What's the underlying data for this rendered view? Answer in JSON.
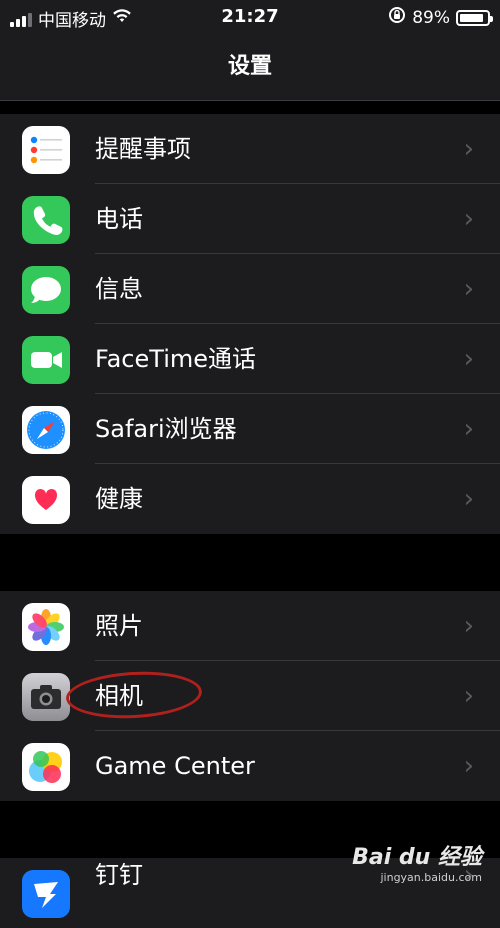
{
  "status_bar": {
    "carrier": "中国移动",
    "time": "21:27",
    "battery_percent": "89%",
    "battery_level": 0.89,
    "wifi_icon": "wifi-icon",
    "rotation_lock_icon": "rotation-lock-icon"
  },
  "nav": {
    "title": "设置"
  },
  "groups": [
    {
      "items": [
        {
          "label": "提醒事项",
          "icon": "reminders-icon",
          "color": "#ffffff"
        },
        {
          "label": "电话",
          "icon": "phone-icon",
          "color": "#34c759"
        },
        {
          "label": "信息",
          "icon": "messages-icon",
          "color": "#34c759"
        },
        {
          "label": "FaceTime通话",
          "icon": "facetime-icon",
          "color": "#34c759"
        },
        {
          "label": "Safari浏览器",
          "icon": "safari-icon",
          "color": "#1e90ff"
        },
        {
          "label": "健康",
          "icon": "health-icon",
          "color": "#ff2d55"
        }
      ]
    },
    {
      "items": [
        {
          "label": "照片",
          "icon": "photos-icon",
          "color": "#ffffff"
        },
        {
          "label": "相机",
          "icon": "camera-icon",
          "color": "#8e8e93"
        },
        {
          "label": "Game Center",
          "icon": "game-center-icon",
          "color": "#ffffff"
        }
      ]
    },
    {
      "items": [
        {
          "label": "钉钉",
          "icon": "dingtalk-icon",
          "color": "#1677ff"
        }
      ]
    }
  ],
  "chevron": "›",
  "watermark": {
    "logo": "Bai du 经验",
    "url": "jingyan.baidu.com"
  }
}
